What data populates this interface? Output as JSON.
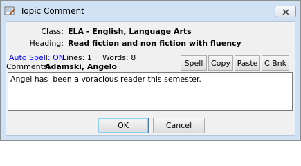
{
  "window": {
    "title": "Topic Comment"
  },
  "info": {
    "class_label": "Class:",
    "class_value": "ELA - English, Language Arts",
    "heading_label": "Heading:",
    "heading_value": "Read fiction and non fiction with fluency"
  },
  "status": {
    "auto_spell": "Auto Spell: ON",
    "lines": "Lines: 1",
    "words": "Words: 8"
  },
  "comments": {
    "label": "Comments:",
    "student": "Adamski, Angelo",
    "text": "Angel has  been a voracious reader this semester."
  },
  "toolbar": {
    "spell": "Spell",
    "copy": "Copy",
    "paste": "Paste",
    "cbnk": "C Bnk"
  },
  "footer": {
    "ok": "OK",
    "cancel": "Cancel"
  },
  "colors": {
    "title_bar": "#cfe1f3",
    "dialog_bg": "#f0f0f0",
    "auto_spell": "#0000ff"
  },
  "icons": {
    "window_icon": "app-icon",
    "close": "close-icon"
  }
}
